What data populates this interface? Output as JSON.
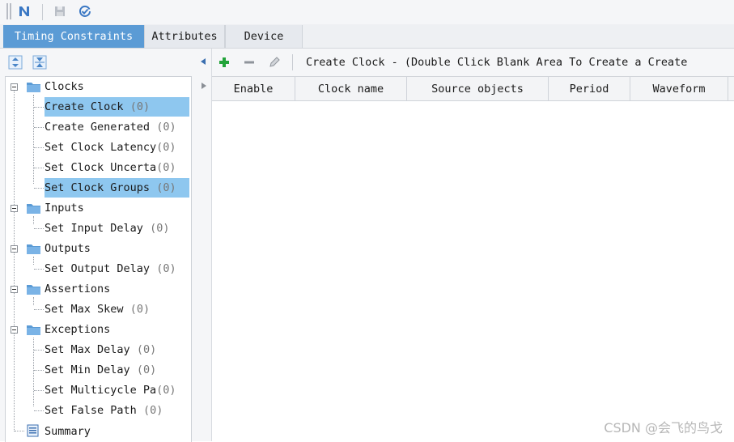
{
  "tabs": [
    "Timing Constraints",
    "Attributes",
    "Device"
  ],
  "tree": {
    "clocks": {
      "label": "Clocks",
      "items": [
        {
          "label": "Create Clock",
          "count": "(0)"
        },
        {
          "label": "Create Generated",
          "count": "(0)"
        },
        {
          "label": "Set Clock Latency",
          "count": "(0)"
        },
        {
          "label": "Set Clock Uncerta",
          "count": "(0)"
        },
        {
          "label": "Set Clock Groups",
          "count": "(0)"
        }
      ]
    },
    "inputs": {
      "label": "Inputs",
      "items": [
        {
          "label": "Set Input Delay",
          "count": "(0)"
        }
      ]
    },
    "outputs": {
      "label": "Outputs",
      "items": [
        {
          "label": "Set Output Delay",
          "count": "(0)"
        }
      ]
    },
    "assertions": {
      "label": "Assertions",
      "items": [
        {
          "label": "Set Max Skew",
          "count": "(0)"
        }
      ]
    },
    "exceptions": {
      "label": "Exceptions",
      "items": [
        {
          "label": "Set Max Delay",
          "count": "(0)"
        },
        {
          "label": "Set Min Delay",
          "count": "(0)"
        },
        {
          "label": "Set Multicycle Pa",
          "count": "(0)"
        },
        {
          "label": "Set False Path",
          "count": "(0)"
        }
      ]
    },
    "summary": {
      "label": "Summary"
    }
  },
  "right": {
    "title": "Create Clock - (Double Click Blank Area To Create a Create",
    "columns": [
      "Enable",
      "Clock name",
      "Source objects",
      "Period",
      "Waveform"
    ]
  },
  "watermark": "CSDN @会飞的鸟戈",
  "colors": {
    "accent": "#5b9bd5",
    "selection": "#8ec7ef",
    "folder": "#5b9bd5",
    "add_green": "#22a33a"
  }
}
